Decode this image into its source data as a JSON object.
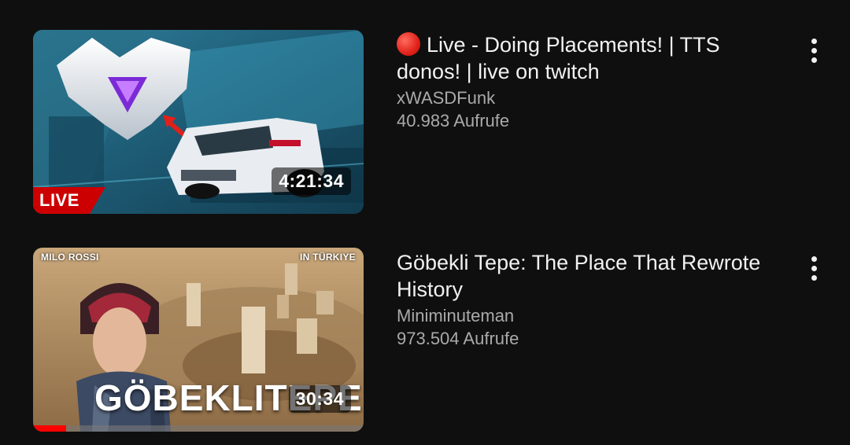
{
  "videos": [
    {
      "title": "Live - Doing Placements! | TTS donos! | live on twitch",
      "live_icon": "red-circle-emoji",
      "channel": "xWASDFunk",
      "views": "40.983 Aufrufe",
      "duration": "4:21:34",
      "badge": "LIVE",
      "menu_icon": "vertical-dots-icon"
    },
    {
      "title": "Göbekli Tepe: The Place That Rewrote History",
      "channel": "Miniminuteman",
      "views": "973.504 Aufrufe",
      "duration": "30:34",
      "thumbnail_text": {
        "top_left": "MILO ROSSI",
        "top_right": "IN TÜRKIYE",
        "big_word": "GÖBEKLITEPE"
      },
      "watch_progress": 0.1,
      "menu_icon": "vertical-dots-icon"
    }
  ],
  "colors": {
    "background": "#0f0f0f",
    "title": "#f1f1f1",
    "secondary_text": "#aaaaaa",
    "live_badge": "#cc0000",
    "progress": "#ff0000"
  }
}
